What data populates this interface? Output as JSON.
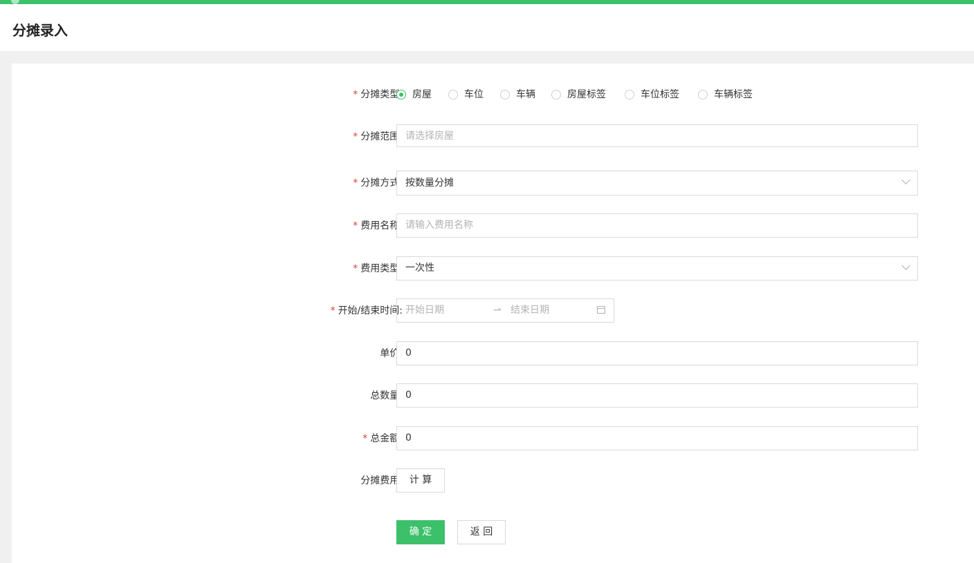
{
  "header": {
    "title": "分摊录入"
  },
  "form": {
    "share_type": {
      "label": "分摊类型:",
      "required": "*",
      "options": [
        {
          "label": "房屋",
          "checked": true
        },
        {
          "label": "车位",
          "checked": false
        },
        {
          "label": "车辆",
          "checked": false
        },
        {
          "label": "房屋标签",
          "checked": false
        },
        {
          "label": "车位标签",
          "checked": false
        },
        {
          "label": "车辆标签",
          "checked": false
        }
      ]
    },
    "share_range": {
      "label": "分摊范围:",
      "required": "*",
      "placeholder": "请选择房屋"
    },
    "share_method": {
      "label": "分摊方式:",
      "required": "*",
      "value": "按数量分摊"
    },
    "fee_name": {
      "label": "费用名称:",
      "required": "*",
      "placeholder": "请输入费用名称"
    },
    "fee_type": {
      "label": "费用类型:",
      "required": "*",
      "value": "一次性"
    },
    "date_range": {
      "label": "开始/结束时间:",
      "required": "*",
      "start_placeholder": "开始日期",
      "separator": "⇀",
      "end_placeholder": "结束日期"
    },
    "unit_price": {
      "label": "单价:",
      "value": "0"
    },
    "total_quantity": {
      "label": "总数量:",
      "value": "0"
    },
    "total_amount": {
      "label": "总金额:",
      "required": "*",
      "value": "0"
    },
    "share_fee": {
      "label": "分摊费用:",
      "calc_button": "计 算"
    }
  },
  "actions": {
    "confirm": "确 定",
    "back": "返 回"
  },
  "colors": {
    "accent": "#3cc06a",
    "required": "#e23b3b"
  }
}
